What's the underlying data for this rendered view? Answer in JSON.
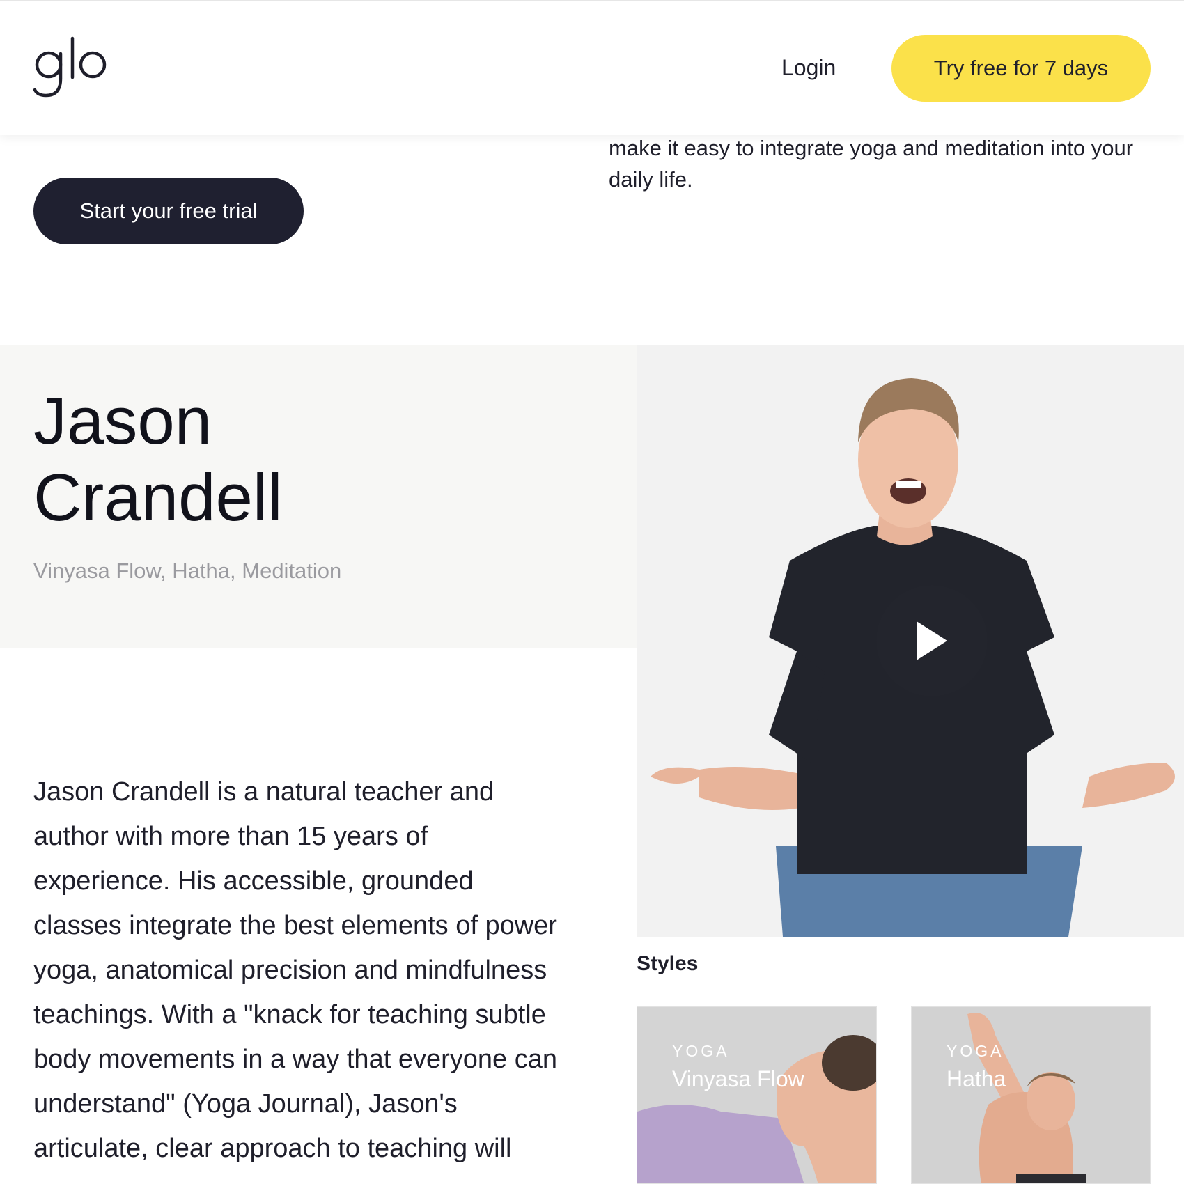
{
  "header": {
    "logo_text": "glo",
    "login_label": "Login",
    "trial_label": "Try free for 7 days"
  },
  "intro": {
    "text_tail": "make it easy to integrate yoga and meditation into your daily life.",
    "cta_label": "Start your free trial"
  },
  "teacher": {
    "first_name": "Jason",
    "last_name": "Crandell",
    "styles": "Vinyasa Flow, Hatha, Meditation",
    "bio": "Jason Crandell is a natural teacher and author with more than 15 years of experience. His accessible, grounded classes integrate the best elements of power yoga, anatomical precision and mindfulness teachings. With a \"knack for teaching subtle body movements in a way that everyone can understand\" (Yoga Journal), Jason's articulate, clear approach to teaching will"
  },
  "video": {
    "play_icon": "play-icon"
  },
  "styles_section": {
    "label": "Styles",
    "cards": [
      {
        "kicker": "YOGA",
        "title": "Vinyasa Flow"
      },
      {
        "kicker": "YOGA",
        "title": "Hatha"
      }
    ]
  },
  "colors": {
    "accent_yellow": "#fbe14a",
    "dark_button": "#1f2030",
    "muted_text": "#9a9a9f"
  }
}
